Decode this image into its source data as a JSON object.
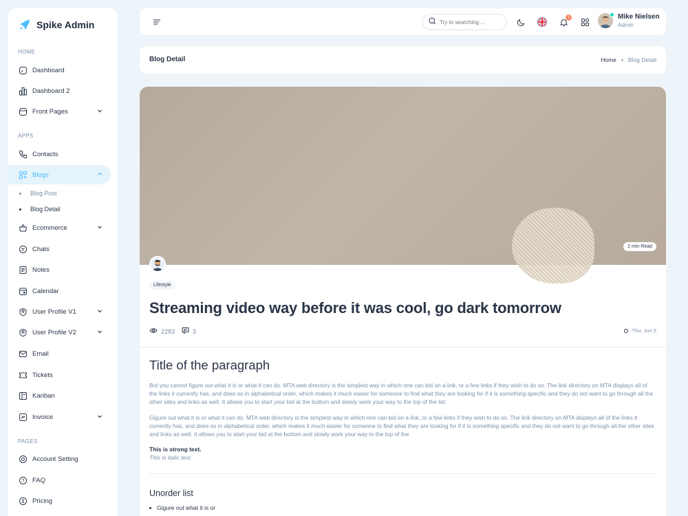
{
  "brand": {
    "name": "Spike Admin",
    "accent": "#49beff"
  },
  "sidebar": {
    "sections": [
      "HOME",
      "APPS",
      "PAGES"
    ],
    "items": [
      {
        "label": "Dashboard",
        "icon": "aperture-icon"
      },
      {
        "label": "Dashboard 2",
        "icon": "chart-bars-icon"
      },
      {
        "label": "Front Pages",
        "icon": "app-window-icon"
      },
      {
        "label": "Contacts",
        "icon": "phone-icon"
      },
      {
        "label": "Blogs",
        "icon": "apps-grid-icon"
      },
      {
        "label": "Ecommerce",
        "icon": "basket-icon"
      },
      {
        "label": "Chats",
        "icon": "message-icon"
      },
      {
        "label": "Notes",
        "icon": "notes-icon"
      },
      {
        "label": "Calendar",
        "icon": "calendar-icon"
      },
      {
        "label": "User Profile V1",
        "icon": "user-circle-icon"
      },
      {
        "label": "User Profile V2",
        "icon": "user-circle-icon"
      },
      {
        "label": "Email",
        "icon": "mail-icon"
      },
      {
        "label": "Tickets",
        "icon": "ticket-icon"
      },
      {
        "label": "Kanban",
        "icon": "kanban-icon"
      },
      {
        "label": "Invoice",
        "icon": "invoice-icon"
      },
      {
        "label": "Account Setting",
        "icon": "settings-circle-icon"
      },
      {
        "label": "FAQ",
        "icon": "help-icon"
      },
      {
        "label": "Pricing",
        "icon": "currency-dollar-icon"
      }
    ],
    "blog_sub": [
      {
        "label": "Blog Post"
      },
      {
        "label": "Blog Detail"
      }
    ]
  },
  "topbar": {
    "search_placeholder": "Try to searching ...",
    "notification_count": "1",
    "user": {
      "name": "Mike Nielsen",
      "role": "Admin"
    }
  },
  "header": {
    "title": "Blog Detail",
    "breadcrumb": [
      "Home",
      "Blog Detail"
    ]
  },
  "article": {
    "read_time": "2 min Read",
    "tag": "Lifestyle",
    "title": "Streaming video way before it was cool, go dark tomorrow",
    "views": "2283",
    "comments": "3",
    "date": "Thu, Jun 5",
    "h2": "Title of the paragraph",
    "p1": "But you cannot figure out what it is or what it can do. MTA web directory is the simplest way in which one can bid on a link, or a few links if they wish to do so. The link directory on MTA displays all of the links it currently has, and does so in alphabetical order, which makes it much easier for someone to find what they are looking for if it is something specific and they do not want to go through all the other sites and links as well. It allows you to start your bid at the bottom and slowly work your way to the top of the list",
    "p2": "Gigure out what it is or what it can do. MTA web directory is the simplest way in which one can bid on a link, or a few links if they wish to do so. The link directory on MTA displays all of the links it currently has, and does so in alphabetical order, which makes it much easier for someone to find what they are looking for if it is something specific and they do not want to go through all the other sites and links as well. It allows you to start your bid at the bottom and slowly work your way to the top of the",
    "strong": "This is strong text.",
    "italic": "This is italic text.",
    "h3": "Unorder list",
    "list": [
      "Gigure out what it is or"
    ]
  }
}
